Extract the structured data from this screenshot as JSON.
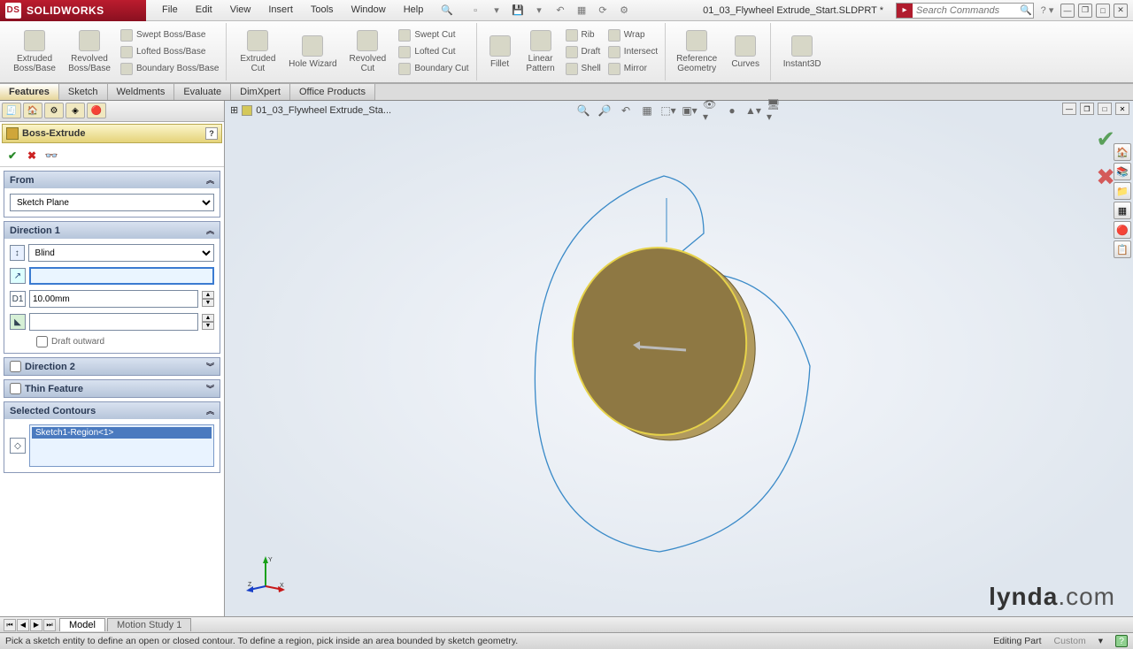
{
  "app": {
    "name": "SOLIDWORKS"
  },
  "menubar": [
    "File",
    "Edit",
    "View",
    "Insert",
    "Tools",
    "Window",
    "Help"
  ],
  "document": {
    "title": "01_03_Flywheel Extrude_Start.SLDPRT *",
    "breadcrumb": "01_03_Flywheel Extrude_Sta..."
  },
  "search": {
    "placeholder": "Search Commands"
  },
  "ribbon": {
    "boss": {
      "extruded": "Extruded Boss/Base",
      "revolved": "Revolved Boss/Base",
      "swept": "Swept Boss/Base",
      "lofted": "Lofted Boss/Base",
      "boundary": "Boundary Boss/Base"
    },
    "cut": {
      "extruded": "Extruded Cut",
      "hole": "Hole Wizard",
      "revolved": "Revolved Cut",
      "swept": "Swept Cut",
      "lofted": "Lofted Cut",
      "boundary": "Boundary Cut"
    },
    "pattern": {
      "fillet": "Fillet",
      "linear": "Linear Pattern",
      "rib": "Rib",
      "draft": "Draft",
      "shell": "Shell",
      "wrap": "Wrap",
      "intersect": "Intersect",
      "mirror": "Mirror"
    },
    "ref": {
      "geometry": "Reference Geometry",
      "curves": "Curves",
      "instant": "Instant3D"
    }
  },
  "feature_tabs": [
    "Features",
    "Sketch",
    "Weldments",
    "Evaluate",
    "DimXpert",
    "Office Products"
  ],
  "pm": {
    "title": "Boss-Extrude",
    "from": {
      "label": "From",
      "value": "Sketch Plane"
    },
    "dir1": {
      "label": "Direction 1",
      "type": "Blind",
      "depth": "10.00mm",
      "draft_outward": "Draft outward"
    },
    "dir2": {
      "label": "Direction 2"
    },
    "thin": {
      "label": "Thin Feature"
    },
    "contours": {
      "label": "Selected Contours",
      "item": "Sketch1-Region<1>"
    }
  },
  "bottom_tabs": {
    "model": "Model",
    "motion": "Motion Study 1"
  },
  "status": {
    "hint": "Pick a sketch entity to define an open or closed contour. To define a region, pick inside an area bounded by sketch geometry.",
    "mode": "Editing Part",
    "custom": "Custom"
  },
  "watermark": {
    "brand": "lynda",
    "suffix": ".com"
  }
}
